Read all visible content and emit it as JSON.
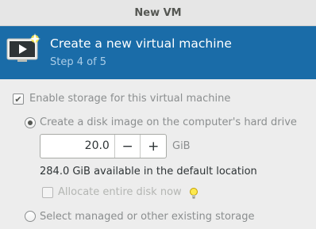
{
  "window": {
    "title": "New VM"
  },
  "header": {
    "title": "Create a new virtual machine",
    "step": "Step 4 of 5",
    "icon": "computer-icon"
  },
  "storage": {
    "enable_label": "Enable storage for this virtual machine",
    "enable_checked": true,
    "create_disk_label": "Create a disk image on the computer's hard drive",
    "create_disk_selected": true,
    "size_value": "20.0",
    "size_unit": "GiB",
    "decrement_label": "−",
    "increment_label": "+",
    "available_text": "284.0 GiB available in the default location",
    "allocate_label": "Allocate entire disk now",
    "allocate_checked": false,
    "managed_label": "Select managed or other existing storage",
    "managed_selected": false
  },
  "colors": {
    "header_bg": "#1a6ca8",
    "header_text": "#ffffff",
    "header_subtext": "#aacde8",
    "window_bg": "#ededed"
  }
}
